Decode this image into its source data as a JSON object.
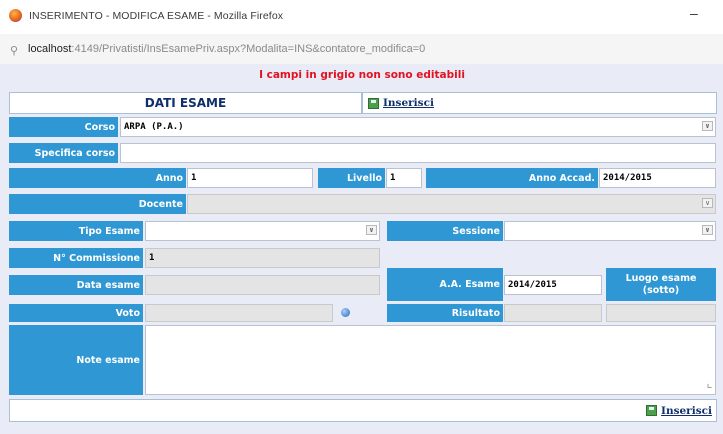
{
  "window": {
    "title": "INSERIMENTO - MODIFICA ESAME - Mozilla Firefox",
    "minimize": "–"
  },
  "address": {
    "host": "localhost",
    "rest": ":4149/Privatisti/InsEsamePriv.aspx?Modalita=INS&contatore_modifica=0"
  },
  "notice": "I campi in grigio non sono editabili",
  "header": {
    "title": "DATI ESAME",
    "insert_label": "Inserisci"
  },
  "form": {
    "corso": {
      "label": "Corso",
      "value": "ARPA (P.A.)"
    },
    "specifica": {
      "label": "Specifica corso",
      "value": ""
    },
    "anno": {
      "label": "Anno",
      "value": "1"
    },
    "livello": {
      "label": "Livello",
      "value": "1"
    },
    "anno_accad": {
      "label": "Anno Accad.",
      "value": "2014/2015"
    },
    "docente": {
      "label": "Docente",
      "value": ""
    },
    "tipo_esame": {
      "label": "Tipo Esame",
      "value": ""
    },
    "sessione": {
      "label": "Sessione",
      "value": ""
    },
    "commissione": {
      "label": "N° Commissione",
      "value": "1"
    },
    "data_esame": {
      "label": "Data esame",
      "value": ""
    },
    "aa_esame": {
      "label": "A.A. Esame",
      "value": "2014/2015"
    },
    "luogo": {
      "label": "Luogo esame (sotto)"
    },
    "voto": {
      "label": "Voto",
      "value": ""
    },
    "risultato": {
      "label": "Risultato",
      "value": ""
    },
    "note": {
      "label": "Note esame",
      "value": ""
    }
  },
  "footer": {
    "insert_label": "Inserisci"
  }
}
